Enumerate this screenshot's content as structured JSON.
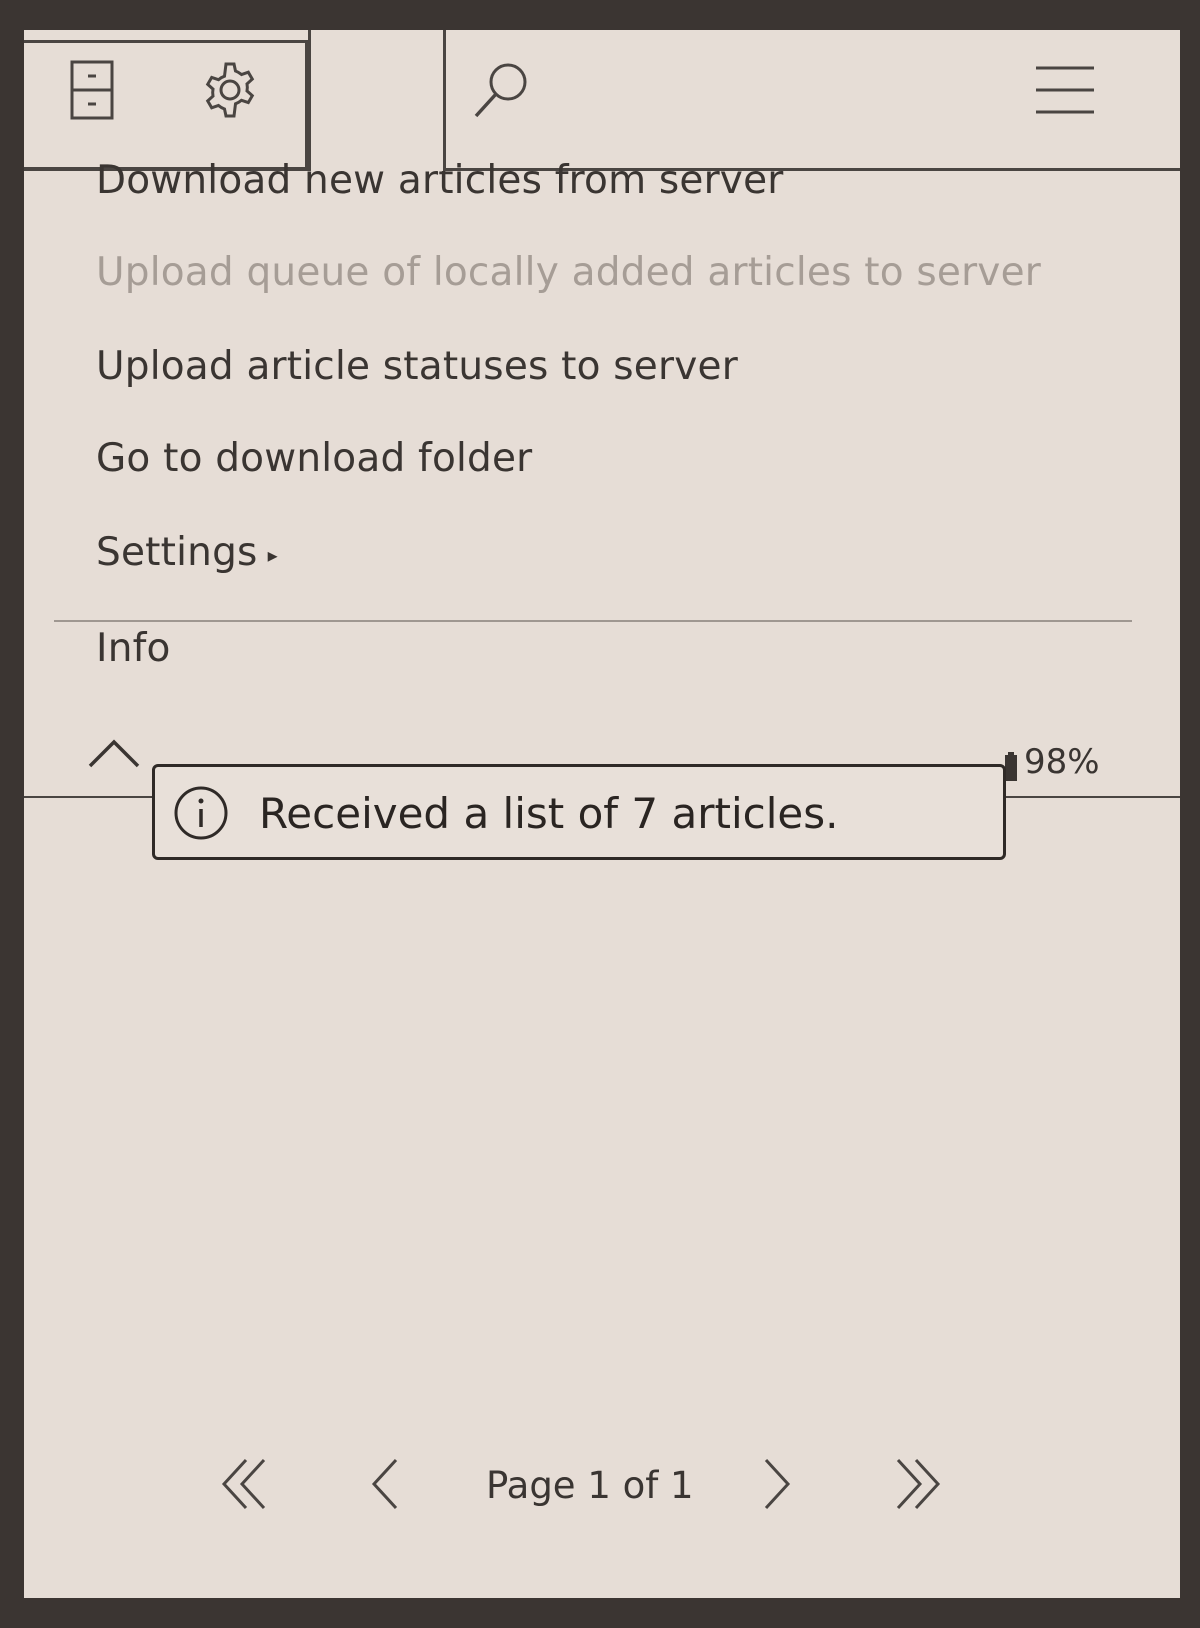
{
  "tabs": [
    {
      "id": "files",
      "icon": "file-cabinet-icon"
    },
    {
      "id": "settings",
      "icon": "gear-icon"
    },
    {
      "id": "tools",
      "icon": "tools-icon",
      "active": true
    },
    {
      "id": "search",
      "icon": "search-icon"
    },
    {
      "id": "menu",
      "icon": "hamburger-menu-icon"
    }
  ],
  "menu": {
    "items": [
      {
        "label": "Download new articles from server",
        "enabled": true
      },
      {
        "label": "Upload queue of locally added articles to server",
        "enabled": false
      },
      {
        "label": "Upload article statuses to server",
        "enabled": true
      },
      {
        "label": "Go to download folder",
        "enabled": true
      },
      {
        "label": "Settings",
        "enabled": true,
        "submenu": true,
        "submenu_glyph": "▸"
      },
      {
        "label": "Info",
        "enabled": true
      }
    ]
  },
  "status": {
    "battery": "98%"
  },
  "notification": {
    "icon": "info-icon",
    "message": "Received a list of 7 articles."
  },
  "footer": {
    "page_indicator": "Page 1 of 1"
  },
  "colors": {
    "screen": "#e6ddd6",
    "text": "#3a3532",
    "disabled_text": "#a69d96",
    "bezel": "#3b3532"
  }
}
